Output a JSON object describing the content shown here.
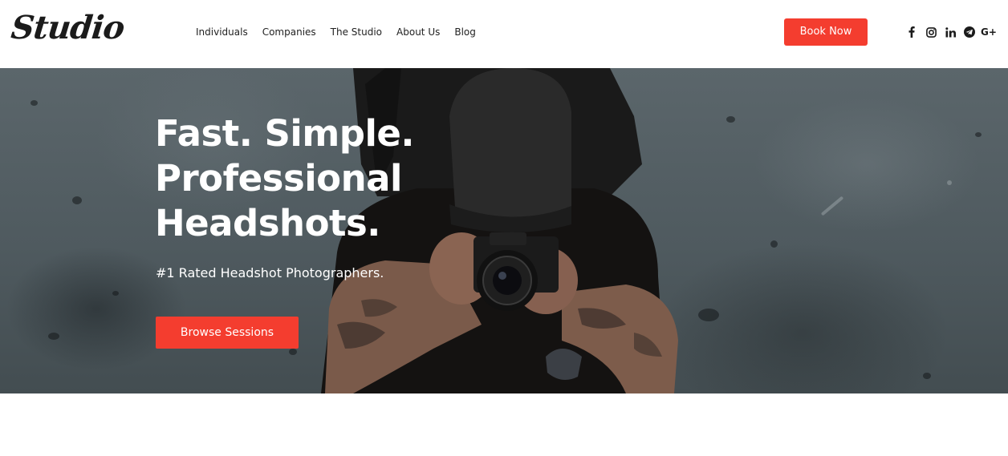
{
  "header": {
    "logo": "Studio",
    "nav": [
      {
        "label": "Individuals"
      },
      {
        "label": "Companies"
      },
      {
        "label": "The Studio"
      },
      {
        "label": "About Us"
      },
      {
        "label": "Blog"
      }
    ],
    "book_label": "Book Now",
    "social": {
      "gplus_label": "G+",
      "icons": [
        "facebook-icon",
        "instagram-icon",
        "linkedin-icon",
        "telegram-icon",
        "google-plus-icon"
      ]
    }
  },
  "hero": {
    "title_lines": [
      "Fast. Simple.",
      "Professional",
      "Headshots."
    ],
    "subtitle": "#1 Rated Headshot Photographers.",
    "cta_label": "Browse Sessions"
  },
  "colors": {
    "accent": "#f43d2f",
    "text_dark": "#1c1c1c",
    "hero_text": "#ffffff"
  }
}
